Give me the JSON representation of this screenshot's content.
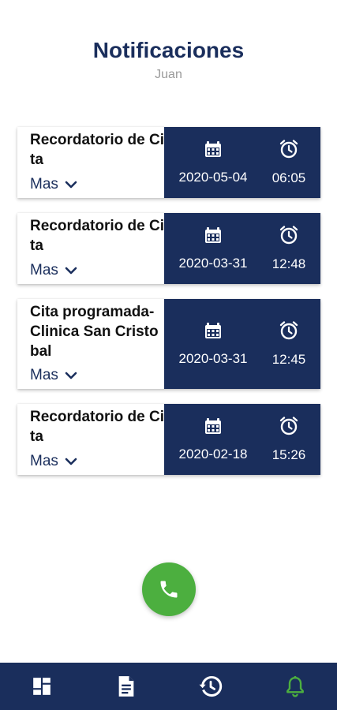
{
  "header": {
    "title": "Notificaciones",
    "subtitle": "Juan"
  },
  "notifications": [
    {
      "title": "Recordatorio de Cita",
      "more_label": "Mas",
      "date": "2020-05-04",
      "time": "06:05"
    },
    {
      "title": "Recordatorio de Cita",
      "more_label": "Mas",
      "date": "2020-03-31",
      "time": "12:48"
    },
    {
      "title": "Cita programada-Clinica San Cristobal",
      "more_label": "Mas",
      "date": "2020-03-31",
      "time": "12:45"
    },
    {
      "title": "Recordatorio de Cita",
      "more_label": "Mas",
      "date": "2020-02-18",
      "time": "15:26"
    }
  ],
  "icons": {
    "date": "calendar-icon",
    "time": "alarm-clock-icon",
    "expand": "chevron-down-icon",
    "call": "phone-icon"
  },
  "bottom_nav": [
    {
      "icon": "dashboard-icon",
      "active": false
    },
    {
      "icon": "document-icon",
      "active": false
    },
    {
      "icon": "history-icon",
      "active": false
    },
    {
      "icon": "bell-icon",
      "active": true
    }
  ],
  "colors": {
    "primary": "#1a2e5c",
    "accent_green": "#4caf3f",
    "subtitle_gray": "#9a9a9a",
    "background": "#ffffff"
  }
}
